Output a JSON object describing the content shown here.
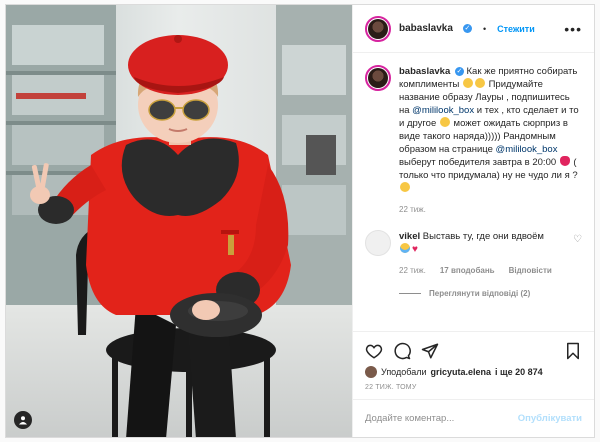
{
  "header": {
    "username": "babaslavka",
    "follow_label": "Стежити",
    "more_label": "•••"
  },
  "caption": {
    "username": "babaslavka",
    "text_1": "Как же приятно собирать комплименты",
    "text_2": "Придумайте название образу Лауры , подпишитесь на",
    "mention_1": "@mililook_box",
    "text_3": "и тех , кто сделает и то и другое",
    "text_4": "может ожидать сюрприз в виде такого наряда))))) Рандомным образом на странице",
    "mention_2": "@mililook_box",
    "text_5": "выберут победителя завтра в 20:00",
    "text_6": "( только что придумала) ну не чудо ли я ?",
    "time": "22 тиж."
  },
  "comment": {
    "username": "vikel",
    "text": "Выставь ту, где они вдвоём",
    "time": "22 тиж.",
    "likes": "17 вподобань",
    "reply_label": "Відповісти",
    "view_replies": "Переглянути відповіді (2)"
  },
  "actions": {
    "liked_by_prefix": "Уподобали",
    "liked_by_user": "gricyuta.elena",
    "liked_by_suffix": "і ще 20 874",
    "timestamp": "22 тиж. тому"
  },
  "add_comment": {
    "placeholder": "Додайте коментар...",
    "post_label": "Опублікувати"
  },
  "colors": {
    "accent": "#0095f6",
    "coat": "#e2231a",
    "hat": "#d8201f"
  },
  "icons": [
    "user-tag-icon",
    "verified-icon",
    "heart-icon",
    "comment-icon",
    "share-icon",
    "bookmark-icon"
  ]
}
